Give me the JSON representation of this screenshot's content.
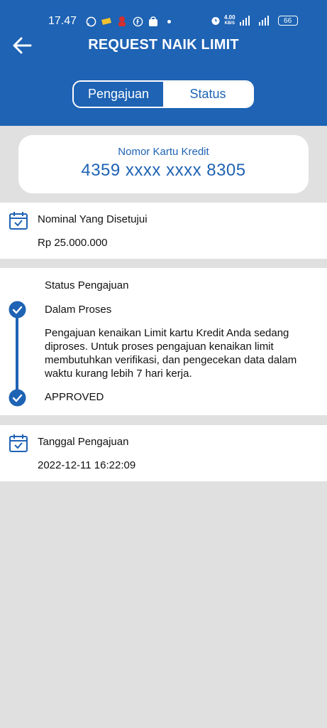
{
  "status_bar": {
    "time": "17.47",
    "net_speed_value": "4.00",
    "net_speed_unit": "KB/S",
    "battery": "66",
    "icons": [
      "whatsapp-icon",
      "ticket-icon",
      "app-icon",
      "facebook-icon",
      "shopping-bag-icon",
      "dot-icon",
      "alarm-icon",
      "4g-signal-icon",
      "signal-icon",
      "battery-icon"
    ]
  },
  "header": {
    "title": "REQUEST NAIK LIMIT",
    "back_icon": "arrow-left-icon"
  },
  "tabs": [
    {
      "label": "Pengajuan",
      "active": true
    },
    {
      "label": "Status",
      "active": false
    }
  ],
  "card": {
    "label": "Nomor Kartu Kredit",
    "number": "4359 xxxx xxxx 8305"
  },
  "nominal": {
    "label": "Nominal Yang Disetujui",
    "value": "Rp 25.000.000",
    "icon": "calendar-icon"
  },
  "status": {
    "heading": "Status Pengajuan",
    "steps": [
      {
        "title": "Dalam Proses",
        "icon": "check-circle-icon"
      },
      {
        "title": "APPROVED",
        "icon": "check-circle-icon"
      }
    ],
    "description": "Pengajuan kenaikan Limit kartu Kredit Anda sedang diproses. Untuk proses pengajuan kenaikan limit membutuhkan verifikasi, dan pengecekan data dalam waktu kurang lebih 7 hari kerja."
  },
  "tanggal": {
    "label": "Tanggal Pengajuan",
    "value": "2022-12-11 16:22:09",
    "icon": "calendar-icon"
  },
  "colors": {
    "primary": "#1e63b4",
    "background": "#e0e0e0",
    "surface": "#ffffff"
  }
}
